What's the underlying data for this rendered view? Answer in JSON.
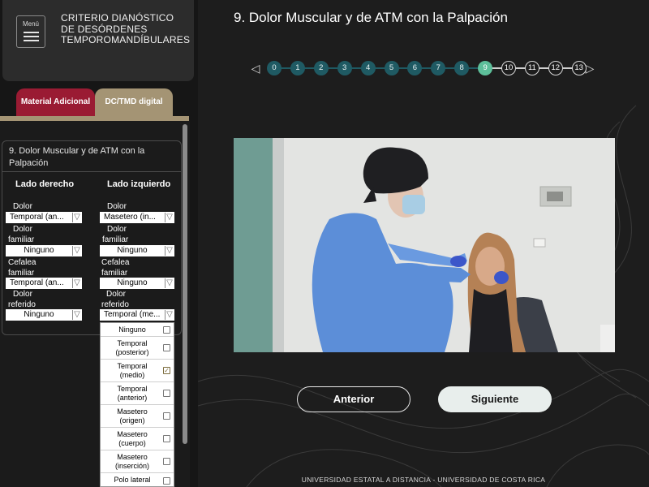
{
  "brand": {
    "menu_label": "Menú",
    "title_line1": "CRITERIO DIANÓSTICO",
    "title_line2": "DE DESÓRDENES",
    "title_line3": "TEMPOROMANDÍBULARES"
  },
  "tabs": [
    {
      "label": "Material Adicional",
      "color": "#9a1b33"
    },
    {
      "label": "DC/TMD digital",
      "color": "#a49474"
    }
  ],
  "form": {
    "title": "9. Dolor Muscular y de ATM con la Palpación",
    "right_header": "Lado derecho",
    "left_header": "Lado izquierdo",
    "right": {
      "dolor_label": "Dolor",
      "dolor_value": "Temporal (an...",
      "familiar_label_1": "Dolor",
      "familiar_label_2": "familiar",
      "familiar_value": "Ninguno",
      "cefalea_label_1": "Cefalea",
      "cefalea_label_2": "familiar",
      "cefalea_value": "Temporal (an...",
      "referido_label_1": "Dolor",
      "referido_label_2": "referido",
      "referido_value": "Ninguno"
    },
    "left": {
      "dolor_label": "Dolor",
      "dolor_value": "Masetero (in...",
      "familiar_label_1": "Dolor",
      "familiar_label_2": "familiar",
      "familiar_value": "Ninguno",
      "cefalea_label_1": "Cefalea",
      "cefalea_label_2": "familiar",
      "cefalea_value": "Ninguno",
      "referido_label_1": "Dolor",
      "referido_label_2": "referido",
      "referido_value": "Temporal (me..."
    },
    "dropdown_options": [
      {
        "l1": "Ninguno",
        "l2": "",
        "checked": false
      },
      {
        "l1": "Temporal",
        "l2": "(posterior)",
        "checked": false
      },
      {
        "l1": "Temporal",
        "l2": "(medio)",
        "checked": true
      },
      {
        "l1": "Temporal",
        "l2": "(anterior)",
        "checked": false
      },
      {
        "l1": "Masetero",
        "l2": "(origen)",
        "checked": false
      },
      {
        "l1": "Masetero",
        "l2": "(cuerpo)",
        "checked": false
      },
      {
        "l1": "Masetero",
        "l2": "(inserción)",
        "checked": false
      },
      {
        "l1": "Polo lateral",
        "l2": "",
        "checked": false
      }
    ]
  },
  "main": {
    "heading": "9. Dolor Muscular y de ATM con la Palpación",
    "steps": [
      "0",
      "1",
      "2",
      "3",
      "4",
      "5",
      "6",
      "7",
      "8",
      "9",
      "10",
      "11",
      "12",
      "13"
    ],
    "current_step": 9,
    "prev_label": "Anterior",
    "next_label": "Siguiente",
    "footer": "UNIVERSIDAD ESTATAL A DISTANCIA - UNIVERSIDAD DE COSTA RICA"
  },
  "colors": {
    "step_done": "#1f5a63",
    "step_current": "#5dbf9a",
    "accent_red": "#9a1b33",
    "accent_gold": "#a49474"
  }
}
